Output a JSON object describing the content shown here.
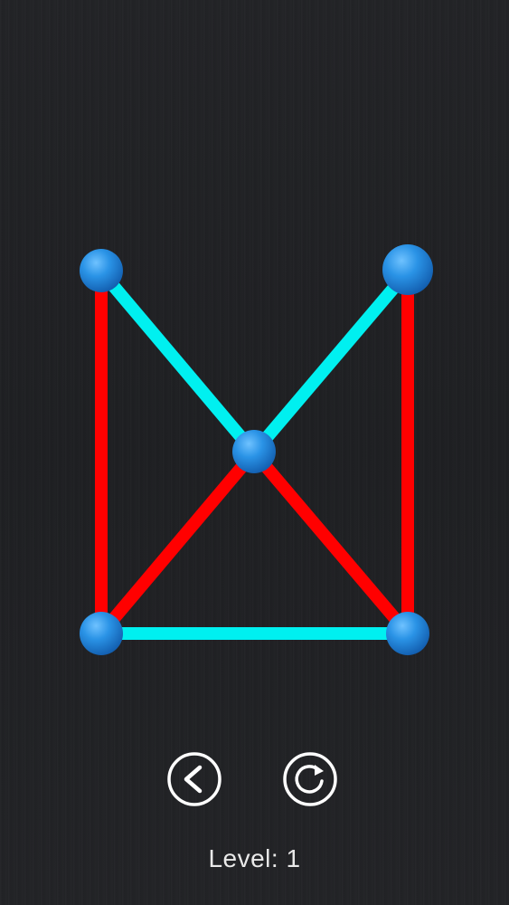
{
  "game": {
    "level_label": "Level:",
    "level_number": "1"
  },
  "colors": {
    "background": "#1f2023",
    "edge_done": "#00f0f0",
    "edge_pending": "#ff0000",
    "node": "#1e88e0",
    "button_stroke": "#ffffff"
  },
  "icons": {
    "back": "chevron-left-circle-icon",
    "restart": "restart-circle-icon"
  }
}
